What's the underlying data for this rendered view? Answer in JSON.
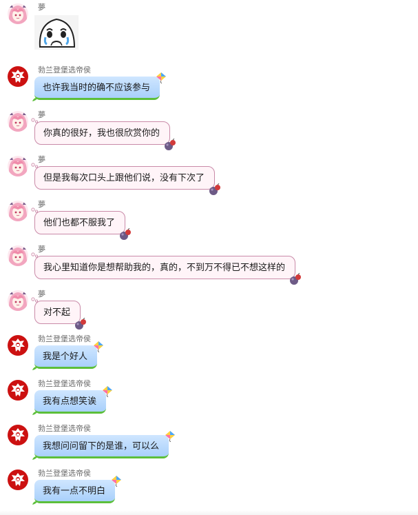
{
  "colors": {
    "pink_bubble_bg": "#fff4f8",
    "pink_bubble_border": "#c98aa8",
    "blue_bubble_top": "#cfe6ff",
    "blue_bubble_bottom": "#a9d0fb",
    "blue_bubble_accent": "#5cbf3a",
    "crest_red": "#cc1111",
    "name_gray": "#6a6a6a"
  },
  "messages": [
    {
      "sender": "夢",
      "side": "a",
      "type": "sticker",
      "icon": "crying-face-sticker"
    },
    {
      "sender": "勃兰登堡选帝侯",
      "side": "b",
      "text": "也许我当时的确不应该参与"
    },
    {
      "sender": "夢",
      "side": "a",
      "text": "你真的很好，我也很欣赏你的"
    },
    {
      "sender": "夢",
      "side": "a",
      "text": "但是我每次口头上跟他们说，没有下次了"
    },
    {
      "sender": "夢",
      "side": "a",
      "text": "他们也都不服我了"
    },
    {
      "sender": "夢",
      "side": "a",
      "text": "我心里知道你是想帮助我的，真的，不到万不得已不想这样的"
    },
    {
      "sender": "夢",
      "side": "a",
      "text": "对不起"
    },
    {
      "sender": "勃兰登堡选帝侯",
      "side": "b",
      "text": "我是个好人"
    },
    {
      "sender": "勃兰登堡选帝侯",
      "side": "b",
      "text": "我有点想笑诶"
    },
    {
      "sender": "勃兰登堡选帝侯",
      "side": "b",
      "text": "我想问问留下的是谁，可以么"
    },
    {
      "sender": "勃兰登堡选帝侯",
      "side": "b",
      "text": "我有一点不明白"
    }
  ]
}
